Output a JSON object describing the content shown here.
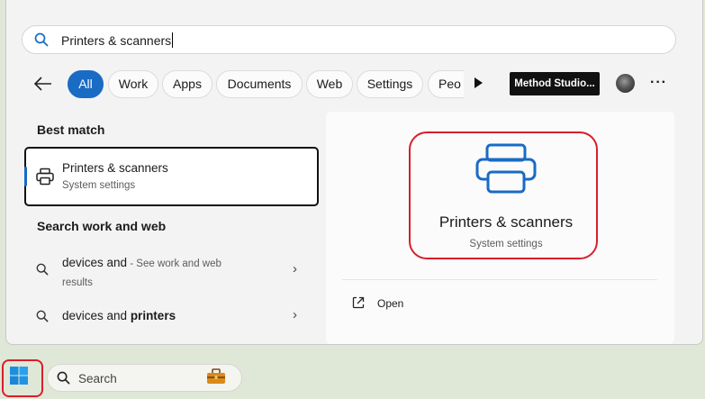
{
  "search": {
    "query": "Printers & scanners"
  },
  "filters": [
    {
      "label": "All",
      "active": true
    },
    {
      "label": "Work"
    },
    {
      "label": "Apps"
    },
    {
      "label": "Documents"
    },
    {
      "label": "Web"
    },
    {
      "label": "Settings"
    },
    {
      "label": "Peo"
    }
  ],
  "account": {
    "org_label": "Method Studio..."
  },
  "best_match": {
    "heading": "Best match",
    "title": "Printers & scanners",
    "subtitle": "System settings"
  },
  "web_section": {
    "heading": "Search work and web",
    "items": [
      {
        "text": "devices and",
        "hint": " - See work and web results"
      },
      {
        "text": "devices and ",
        "bold": "printers"
      }
    ]
  },
  "detail": {
    "title": "Printers & scanners",
    "subtitle": "System settings",
    "actions": [
      {
        "label": "Open"
      }
    ]
  },
  "taskbar": {
    "search_label": "Search"
  },
  "colors": {
    "accent": "#1a6bc4",
    "highlight": "#d81e2c"
  },
  "icons": {
    "search": "search-icon",
    "back": "back-arrow-icon",
    "printer": "printer-icon",
    "open": "open-external-icon",
    "windows": "windows-logo-icon",
    "work": "briefcase-icon"
  }
}
